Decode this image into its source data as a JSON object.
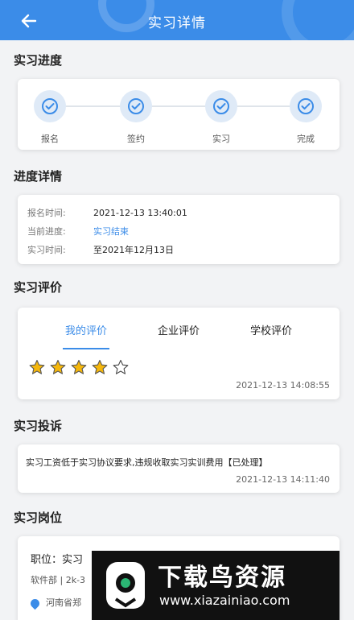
{
  "header": {
    "title": "实习详情"
  },
  "progress": {
    "section_title": "实习进度",
    "steps": [
      {
        "label": "报名"
      },
      {
        "label": "签约"
      },
      {
        "label": "实习"
      },
      {
        "label": "完成"
      }
    ]
  },
  "details": {
    "section_title": "进度详情",
    "rows": [
      {
        "key": "报名时间:",
        "value": "2021-12-13 13:40:01"
      },
      {
        "key": "当前进度:",
        "value": "实习结束"
      },
      {
        "key": "实习时间:",
        "value": "至2021年12月13日"
      }
    ]
  },
  "evaluation": {
    "section_title": "实习评价",
    "tabs": [
      {
        "label": "我的评价"
      },
      {
        "label": "企业评价"
      },
      {
        "label": "学校评价"
      }
    ],
    "active_tab": 0,
    "rating": 4,
    "rating_max": 5,
    "timestamp": "2021-12-13 14:08:55"
  },
  "complaint": {
    "section_title": "实习投诉",
    "text": "实习工资低于实习协议要求,违规收取实习实训费用【已处理】",
    "timestamp": "2021-12-13 14:11:40"
  },
  "position": {
    "section_title": "实习岗位",
    "title": "职位：实习",
    "sub": "软件部 | 2k-3",
    "location": "河南省郑"
  },
  "watermark": {
    "text1": "下载鸟资源",
    "text2": "www.xiazainiao.com"
  },
  "colors": {
    "accent": "#3b8ce8",
    "star": "#f5b70c"
  }
}
